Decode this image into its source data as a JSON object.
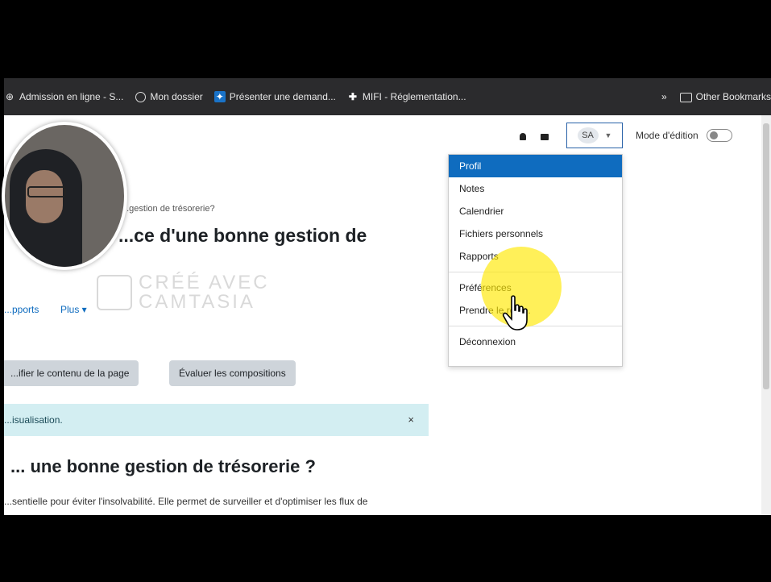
{
  "bookmarks": {
    "items": [
      {
        "label": "Admission en ligne - S...",
        "icon": "bookmark-icon"
      },
      {
        "label": "Mon dossier",
        "icon": "globe-icon"
      },
      {
        "label": "Présenter une demand...",
        "icon": "canada-flag-icon"
      },
      {
        "label": "MIFI - Réglementation...",
        "icon": "quebec-flag-icon"
      }
    ],
    "overflow": "»",
    "other": "Other Bookmarks"
  },
  "header": {
    "user_initials": "SA",
    "edit_mode_label": "Mode d'édition"
  },
  "user_dropdown": {
    "items": [
      {
        "label": "Profil",
        "active": true
      },
      {
        "label": "Notes"
      },
      {
        "label": "Calendrier"
      },
      {
        "label": "Fichiers personnels"
      },
      {
        "label": "Rapports"
      },
      {
        "label": "Préférences"
      },
      {
        "label": "Prendre le rôle..."
      },
      {
        "label": "Déconnexion"
      }
    ]
  },
  "page": {
    "breadcrumb": "...gestion de trésorerie?",
    "title": "...ce d'une bonne gestion de",
    "nav": {
      "reports": "...pports",
      "more": "Plus ▾"
    },
    "buttons": {
      "edit_content": "...ifier le contenu de la page",
      "evaluate": "Évaluer les compositions"
    },
    "alert": {
      "text": "...isualisation.",
      "close": "×"
    },
    "heading": "... une bonne gestion de trésorerie ?",
    "paragraph": "...sentielle pour éviter l'insolvabilité. Elle permet de surveiller et d'optimiser les flux de"
  },
  "watermark": {
    "line1": "CRÉÉ AVEC",
    "line2": "CAMTASIA"
  },
  "colors": {
    "primary": "#0f6cbf",
    "alert_bg": "#d3eef2",
    "button_bg": "#ced4da",
    "highlight": "#ffe800"
  }
}
